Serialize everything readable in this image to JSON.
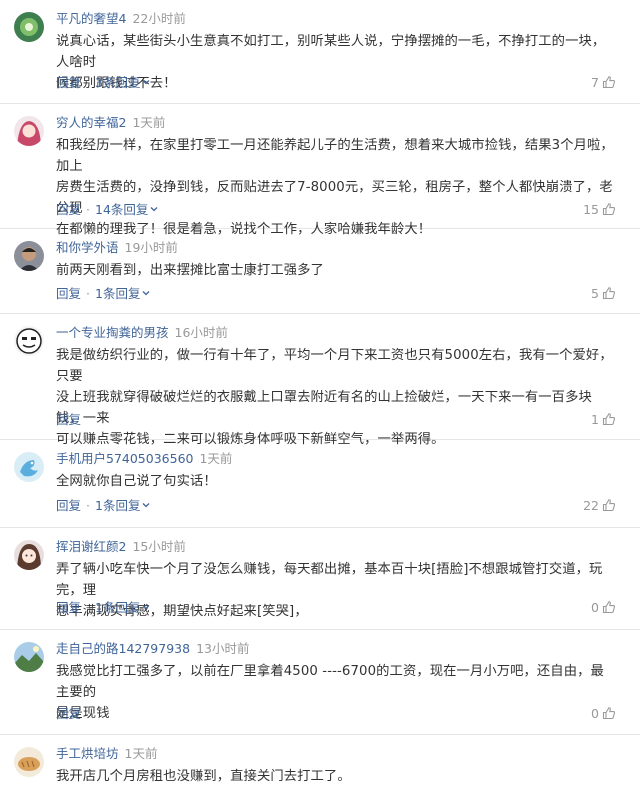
{
  "comments": [
    {
      "user": "平凡的奢望4",
      "time": "22小时前",
      "lines": [
        "说真心话，某些街头小生意真不如打工，别听某些人说，宁挣摆摊的一毛，不挣打工的一块，人啥时",
        "候都别跟钱过不去！"
      ],
      "reply_label": "回复",
      "replies_label": "3条回复",
      "likes": "7",
      "avatar": "green-icon-avatar"
    },
    {
      "user": "穷人的幸福2",
      "time": "1天前",
      "lines": [
        "和我经历一样，在家里打零工一月还能养起儿子的生活费，想着来大城市捡钱，结果3个月啦，加上",
        "房费生活费的，没挣到钱，反而贴进去了7-8000元，买三轮，租房子，整个人都快崩溃了，老公现",
        "在都懒的理我了！很是着急，说找个工作，人家哈嫌我年龄大！"
      ],
      "reply_label": "回复",
      "replies_label": "14条回复",
      "likes": "15",
      "avatar": "pink-hair-avatar"
    },
    {
      "user": "和你学外语",
      "time": "19小时前",
      "lines": [
        "前两天刚看到，出来摆摊比富士康打工强多了"
      ],
      "reply_label": "回复",
      "replies_label": "1条回复",
      "likes": "5",
      "avatar": "man-photo-avatar"
    },
    {
      "user": "一个专业掏粪的男孩",
      "time": "16小时前",
      "lines": [
        "我是做纺织行业的，做一行有十年了，平均一个月下来工资也只有5000左右，我有一个爱好，只要",
        "没上班我就穿得破破烂烂的衣服戴上口罩去附近有名的山上捡破烂，一天下来一有一百多块钱，一来",
        "可以赚点零花钱，二来可以锻炼身体呼吸下新鲜空气，一举两得。"
      ],
      "reply_label": "回复",
      "replies_label": "",
      "likes": "1",
      "avatar": "cartoon-face-avatar"
    },
    {
      "user": "手机用户57405036560",
      "time": "1天前",
      "lines": [
        "全网就你自己说了句实话！"
      ],
      "reply_label": "回复",
      "replies_label": "1条回复",
      "likes": "22",
      "avatar": "default-phone-user-avatar"
    },
    {
      "user": "挥泪谢红颜2",
      "time": "15小时前",
      "lines": [
        "弄了辆小吃车快一个月了没怎么赚钱，每天都出摊，基本百十块[捂脸]不想跟城管打交道，玩完，理",
        "想丰满现实骨感，期望快点好起来[笑哭]，"
      ],
      "reply_label": "回复",
      "replies_label": "1条回复",
      "likes": "0",
      "avatar": "anime-girl-avatar"
    },
    {
      "user": "走自己的路142797938",
      "time": "13小时前",
      "lines": [
        "我感觉比打工强多了，以前在厂里拿着4500 ----6700的工资，现在一月小万吧，还自由，最主要的",
        "是是现钱"
      ],
      "reply_label": "回复",
      "replies_label": "",
      "likes": "0",
      "avatar": "landscape-avatar"
    },
    {
      "user": "手工烘培坊",
      "time": "1天前",
      "lines": [
        "我开店几个月房租也没赚到，直接关门去打工了。"
      ],
      "reply_label": "",
      "replies_label": "",
      "likes": "",
      "avatar": "bread-avatar"
    }
  ],
  "colors": {
    "username": "#406599",
    "meta": "#999999",
    "text": "#333333",
    "divider": "#e6e6e6"
  }
}
